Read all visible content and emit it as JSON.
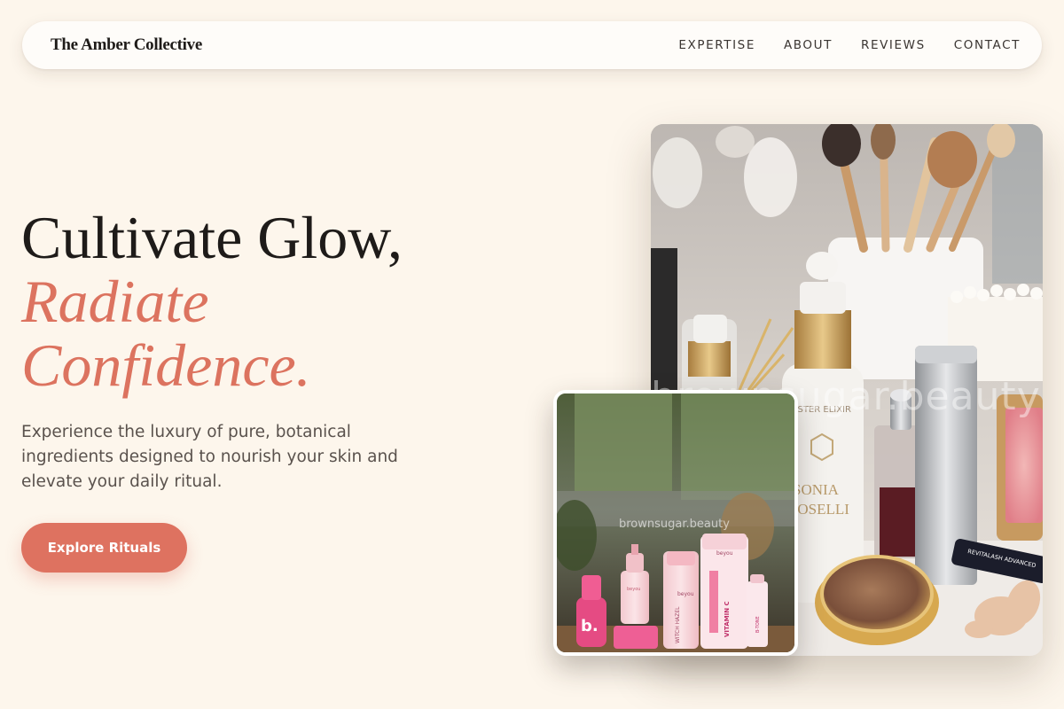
{
  "brand": {
    "name": "The Amber Collective"
  },
  "nav": {
    "links": [
      {
        "label": "EXPERTISE"
      },
      {
        "label": "ABOUT"
      },
      {
        "label": "REVIEWS"
      },
      {
        "label": "CONTACT"
      }
    ]
  },
  "hero": {
    "headline_line1": "Cultivate Glow,",
    "headline_line2": "Radiate",
    "headline_line3": "Confidence.",
    "lead": "Experience the luxury of pure, botanical ingredients designed to nourish your skin and elevate your daily ritual.",
    "cta_label": "Explore Rituals"
  },
  "images": {
    "main": {
      "watermark": "brownsugar.beauty",
      "bottle_brand_line1": "SONIA",
      "bottle_brand_line2": "ROSELLI",
      "bottle_small_text": "MASTER ELIXIR",
      "mascara_text": "REVITALASH ADVANCED"
    },
    "inset": {
      "watermark": "brownsugar.beauty",
      "product_brand": "beyou",
      "tube_label": "VITAMIN C",
      "witch_hazel_label": "WITCH HAZEL",
      "tube_small_label": "B-TONE",
      "jar_letter": "b."
    }
  },
  "colors": {
    "background": "#fdf6ec",
    "accent": "#dc735f",
    "cta": "#de7260",
    "text_dark": "#1e1b19",
    "text_muted": "#5a524d"
  }
}
